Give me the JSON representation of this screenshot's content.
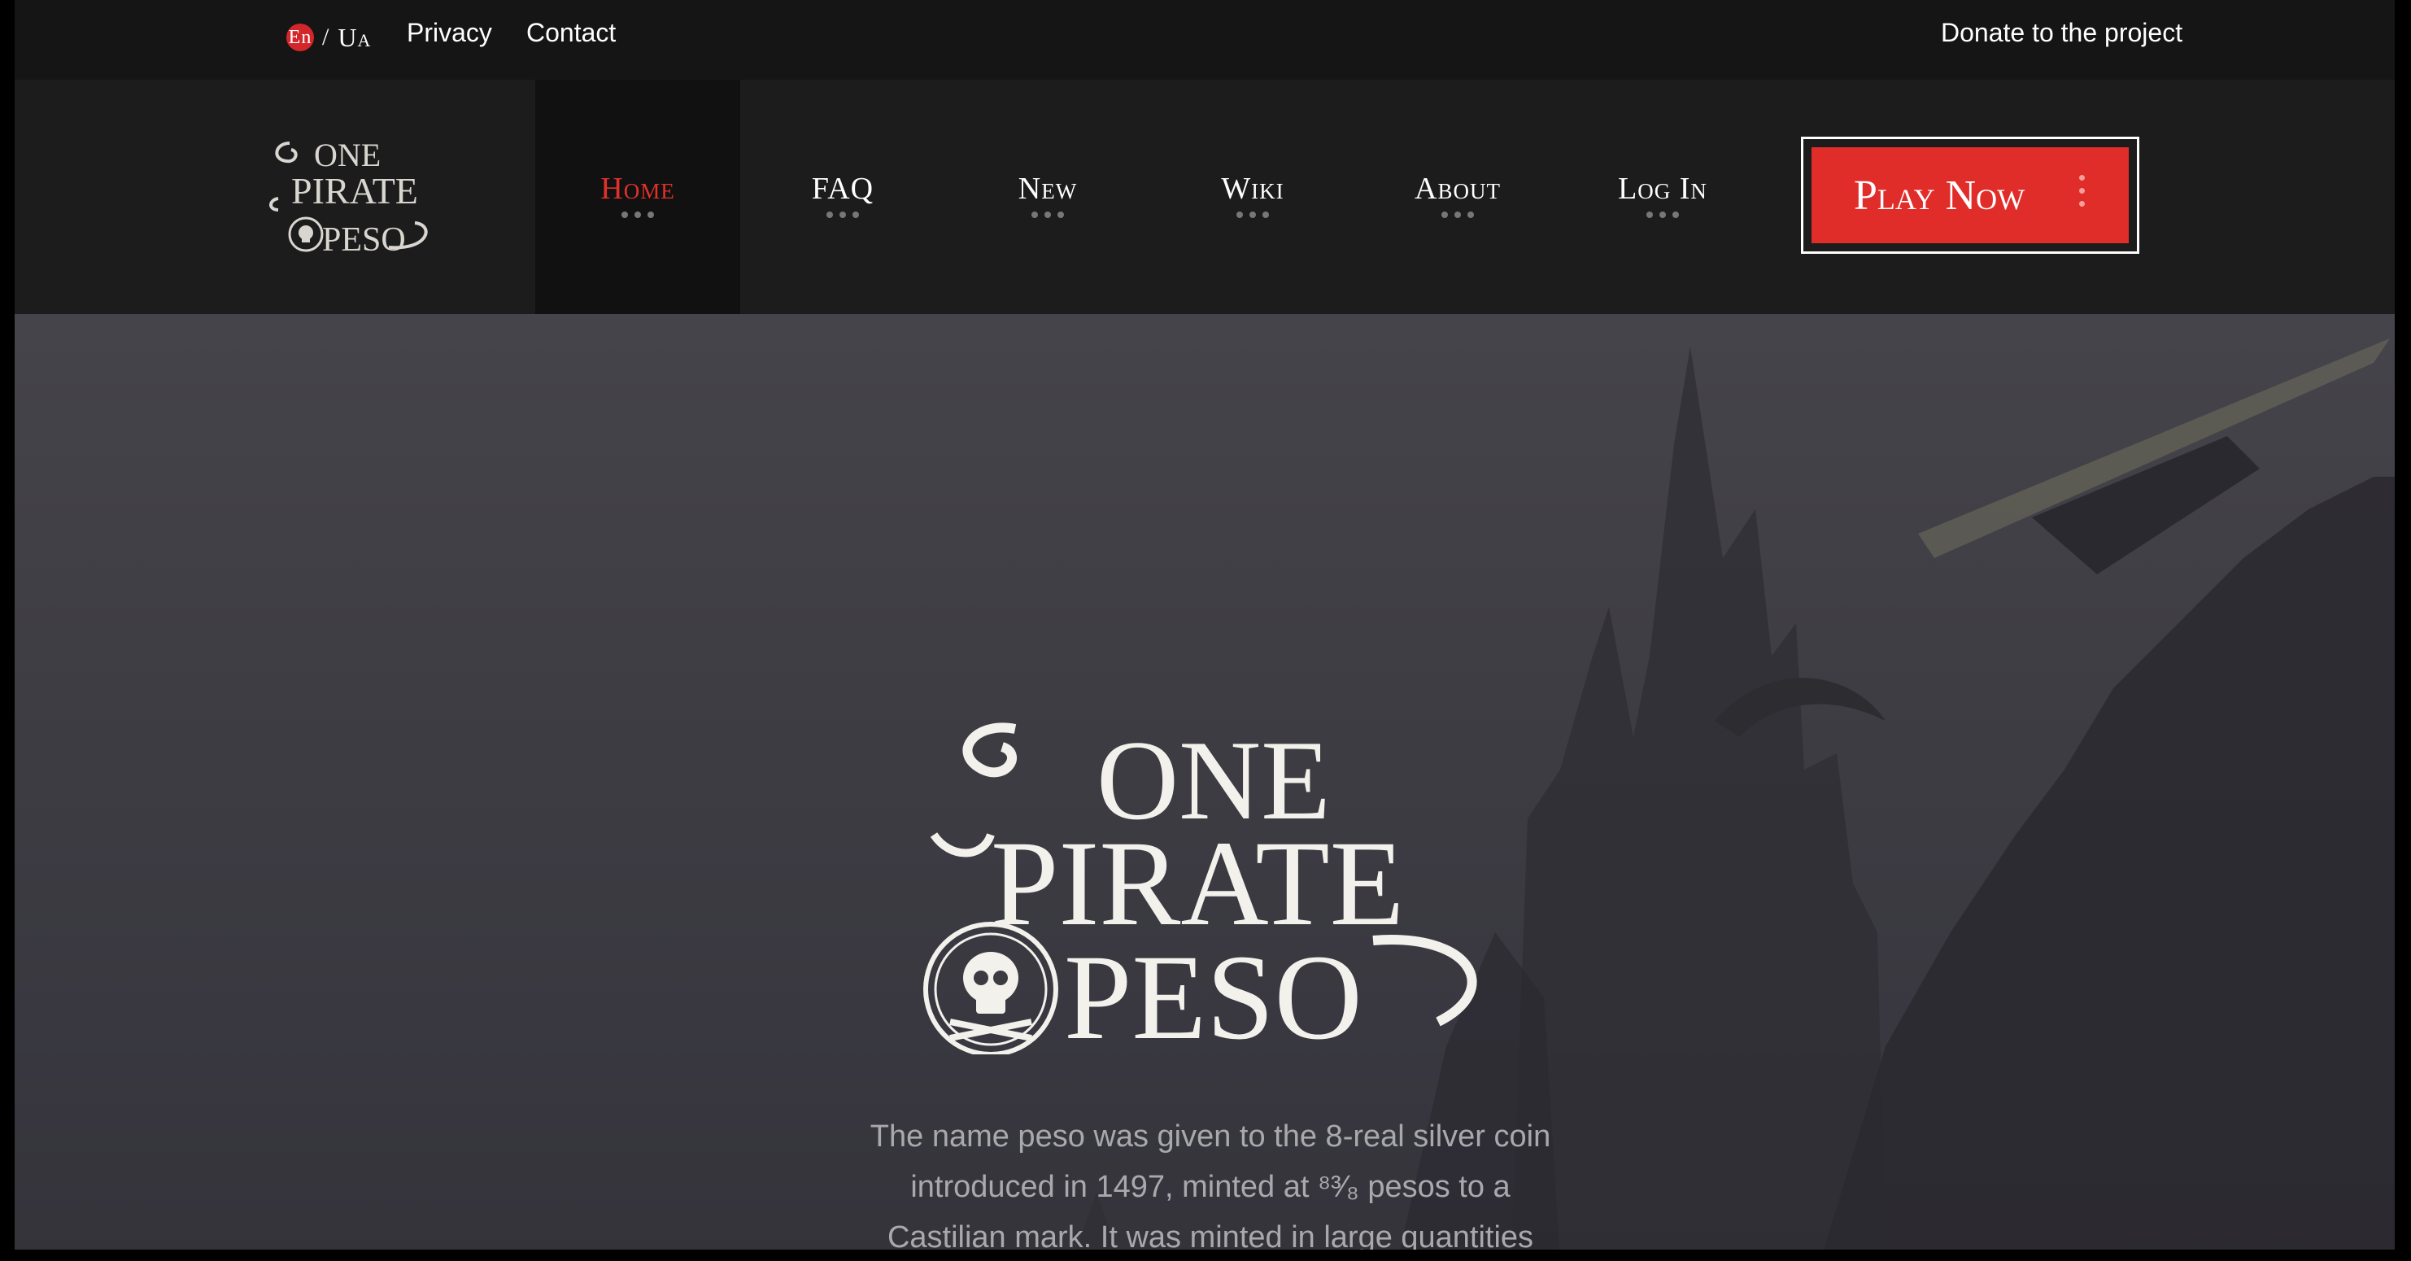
{
  "topbar": {
    "lang_active": "En",
    "lang_separator": "/",
    "lang_other": "Ua",
    "privacy": "Privacy",
    "contact": "Contact",
    "donate": "Donate to the project"
  },
  "logo": {
    "line1": "ONE",
    "line2": "PIRATE",
    "line3": "PESO"
  },
  "nav": {
    "items": [
      {
        "label": "Home"
      },
      {
        "label": "FAQ"
      },
      {
        "label": "New"
      },
      {
        "label": "Wiki"
      },
      {
        "label": "About"
      },
      {
        "label": "Log In"
      }
    ],
    "play": "Play Now"
  },
  "hero": {
    "logo_line1": "ONE",
    "logo_line2": "PIRATE",
    "logo_line3": "PESO",
    "description_line1": "The name peso was given to the 8-real silver coin",
    "description_line2": "introduced in 1497, minted at ⁸³⁄₈ pesos to a",
    "description_line3": "Castilian mark. It was minted in large quantities"
  },
  "colors": {
    "accent": "#e12d2a",
    "nav_bg": "#1c1c1c",
    "topbar_bg": "#151515",
    "hero_text": "#a9a9ad"
  }
}
